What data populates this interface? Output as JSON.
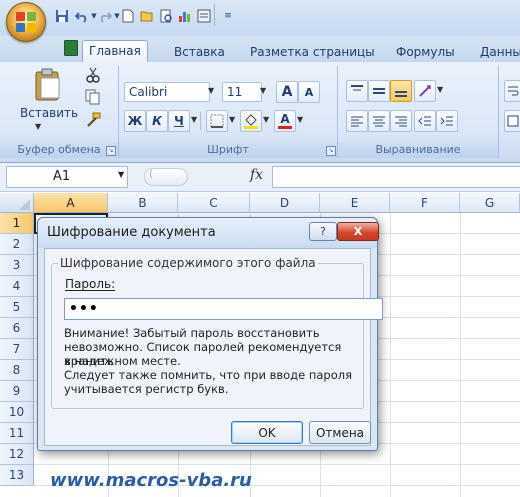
{
  "tabs": [
    "Главная",
    "Вставка",
    "Разметка страницы",
    "Формулы",
    "Данны"
  ],
  "ribbon": {
    "paste_label": "Вставить",
    "font_name": "Calibri",
    "font_size": "11",
    "bold_label": "Ж",
    "italic_label": "К",
    "underline_label": "Ч",
    "grow_font_label": "A",
    "shrink_font_label": "A",
    "font_color_label": "A",
    "groups": [
      "Буфер обмена",
      "Шрифт",
      "Выравнивание"
    ]
  },
  "formula_bar": {
    "cell_ref": "A1",
    "fx_label": "fx"
  },
  "columns": [
    "A",
    "B",
    "C",
    "D",
    "E",
    "F",
    "G"
  ],
  "rows": [
    "1",
    "2",
    "3",
    "4",
    "5",
    "6",
    "7",
    "8",
    "9",
    "10",
    "11",
    "12",
    "13"
  ],
  "dialog": {
    "title": "Шифрование документа",
    "help_label": "?",
    "close_label": "X",
    "group_label": "Шифрование содержимого этого файла",
    "password_label": "Пароль:",
    "password_value": "•••",
    "warning_lines": [
      "Внимание! Забытый пароль восстановить",
      "невозможно. Список паролей рекомендуется хранить",
      "в надежном месте.",
      "Следует также помнить, что при вводе пароля",
      "учитывается регистр букв."
    ],
    "ok_label": "OK",
    "cancel_label": "Отмена"
  },
  "watermark": "www.macros-vba.ru",
  "colors": {
    "accent": "#2a5ca8",
    "close_button": "#d7472e",
    "selected_header": "#f6c86a"
  }
}
